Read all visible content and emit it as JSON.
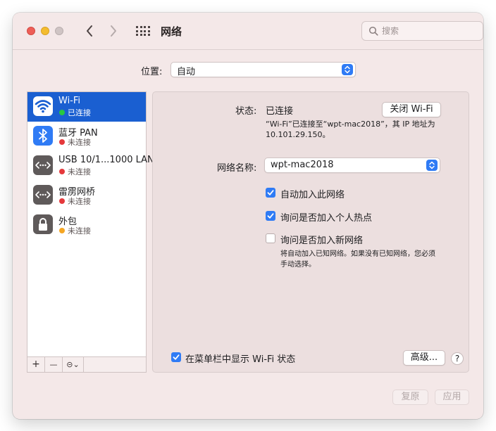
{
  "window": {
    "title": "网络"
  },
  "search": {
    "placeholder": "搜索"
  },
  "location": {
    "label": "位置:",
    "value": "自动"
  },
  "services": [
    {
      "name": "Wi-Fi",
      "status": "已连接",
      "status_color": "#28c840",
      "icon": "wifi-icon",
      "selected": true
    },
    {
      "name": "蓝牙 PAN",
      "status": "未连接",
      "status_color": "#e5383b",
      "icon": "bluetooth-icon"
    },
    {
      "name": "USB 10/1...1000 LAN",
      "status": "未连接",
      "status_color": "#e5383b",
      "icon": "ethernet-icon"
    },
    {
      "name": "雷雳网桥",
      "status": "未连接",
      "status_color": "#e5383b",
      "icon": "ethernet-icon"
    },
    {
      "name": "外包",
      "status": "未连接",
      "status_color": "#f5a623",
      "icon": "lock-icon"
    }
  ],
  "sidebar_actions": {
    "add": "+",
    "remove": "—",
    "more": "⊝⌄"
  },
  "detail": {
    "status_label": "状态:",
    "status_value": "已连接",
    "turn_off_wifi": "关闭 Wi-Fi",
    "status_desc_line1": "“Wi-Fi”已连接至“wpt-mac2018”，其 IP 地址为",
    "status_desc_line2": "10.101.29.150。",
    "network_name_label": "网络名称:",
    "network_name_value": "wpt-mac2018",
    "options": [
      {
        "label": "自动加入此网络",
        "checked": true
      },
      {
        "label": "询问是否加入个人热点",
        "checked": true
      },
      {
        "label": "询问是否加入新网络",
        "checked": false
      }
    ],
    "new_network_note_line1": "将自动加入已知网络。如果没有已知网络，您必须",
    "new_network_note_line2": "手动选择。",
    "show_in_menubar": {
      "label": "在菜单栏中显示 Wi-Fi 状态",
      "checked": true
    },
    "advanced": "高级...",
    "help": "?"
  },
  "footer": {
    "revert": "复原",
    "apply": "应用"
  },
  "colors": {
    "accent": "#2f7bf5",
    "selection": "#1a5fd1"
  }
}
